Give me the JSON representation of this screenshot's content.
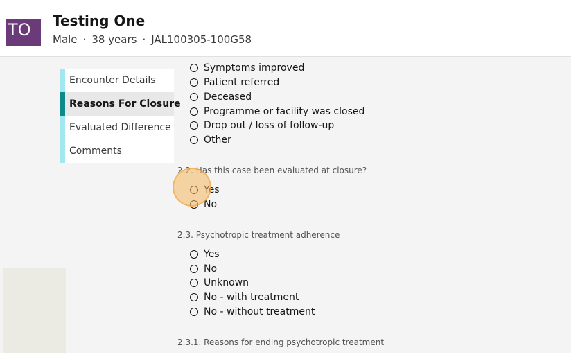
{
  "patient": {
    "initials": "TO",
    "name": "Testing One",
    "gender": "Male",
    "age": "38 years",
    "id": "JAL100305-100G58",
    "separator": "·"
  },
  "nav": {
    "items": [
      {
        "label": "Encounter Details",
        "active": false
      },
      {
        "label": "Reasons For Closure",
        "active": true
      },
      {
        "label": "Evaluated Difference",
        "active": false
      },
      {
        "label": "Comments",
        "active": false
      }
    ]
  },
  "form": {
    "closure_options": [
      "Symptoms improved",
      "Patient referred",
      "Deceased",
      "Programme or facility was closed",
      "Drop out / loss of follow-up",
      "Other"
    ],
    "q22": {
      "label": "2.2. Has this case been evaluated at closure?",
      "options": [
        "Yes",
        "No"
      ]
    },
    "q23": {
      "label": "2.3. Psychotropic treatment adherence",
      "options": [
        "Yes",
        "No",
        "Unknown",
        "No - with treatment",
        "No - without treatment"
      ]
    },
    "q231": {
      "label": "2.3.1. Reasons for ending psychotropic treatment"
    }
  },
  "colors": {
    "nav_accent": "#a3e7f0",
    "nav_active_accent": "#0e8a8a",
    "avatar_bg": "#6b3a78",
    "cursor_highlight": "#f6b65c"
  }
}
